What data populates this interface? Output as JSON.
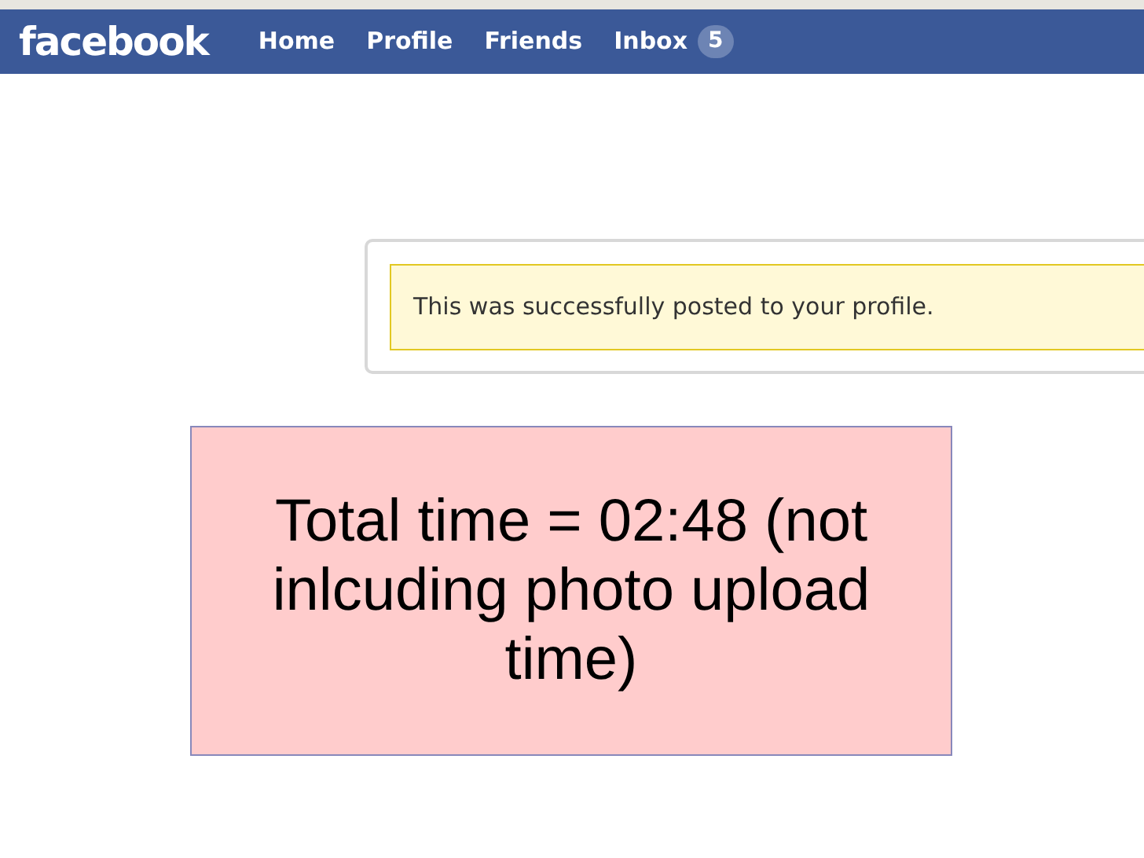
{
  "header": {
    "logo": "facebook",
    "nav": [
      {
        "label": "Home"
      },
      {
        "label": "Profile"
      },
      {
        "label": "Friends"
      },
      {
        "label": "Inbox",
        "badge": "5"
      }
    ]
  },
  "notice": {
    "message": "This was successfully posted to your profile."
  },
  "annotation": {
    "text": "Total time = 02:48 (not inlcuding photo upload time)"
  }
}
